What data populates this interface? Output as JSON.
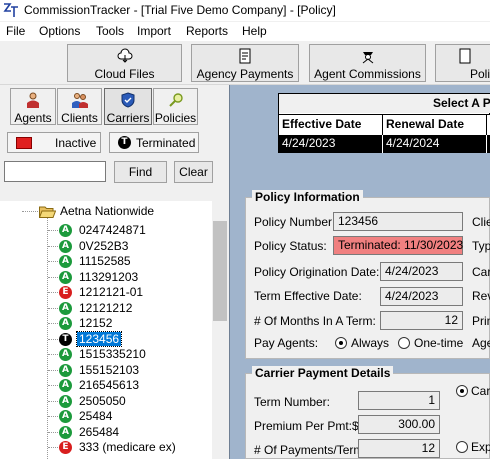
{
  "window": {
    "title": "CommissionTracker - [Trial Five Demo Company] - [Policy]"
  },
  "menu": [
    "File",
    "Options",
    "Tools",
    "Import",
    "Reports",
    "Help"
  ],
  "toolbar": {
    "cloud_files": "Cloud Files",
    "agency_payments": "Agency Payments",
    "agent_commissions": "Agent Commissions",
    "policies_partial": "Poli"
  },
  "left_tabs": {
    "agents": "Agents",
    "clients": "Clients",
    "carriers": "Carriers",
    "policies": "Policies"
  },
  "filters": {
    "inactive": "Inactive",
    "terminated": "Terminated"
  },
  "search": {
    "value": "",
    "find": "Find",
    "clear": "Clear"
  },
  "tree": {
    "root": "Aetna Nationwide",
    "items": [
      {
        "label": "0247424871",
        "status": "A"
      },
      {
        "label": "0V252B3",
        "status": "A"
      },
      {
        "label": "11152585",
        "status": "A"
      },
      {
        "label": "113291203",
        "status": "A"
      },
      {
        "label": "1212121-01",
        "status": "E"
      },
      {
        "label": "12121212",
        "status": "A"
      },
      {
        "label": "12152",
        "status": "A"
      },
      {
        "label": "123456",
        "status": "T"
      },
      {
        "label": "1515335210",
        "status": "A"
      },
      {
        "label": "155152103",
        "status": "A"
      },
      {
        "label": "216545613",
        "status": "A"
      },
      {
        "label": "2505050",
        "status": "A"
      },
      {
        "label": "25484",
        "status": "A"
      },
      {
        "label": "265484",
        "status": "A"
      },
      {
        "label": "333 (medicare ex)",
        "status": "E"
      }
    ]
  },
  "grid": {
    "title": "Select A P",
    "headers": [
      "Effective Date",
      "Renewal Date",
      "S"
    ],
    "row": [
      "4/24/2023",
      "4/24/2024",
      "T"
    ]
  },
  "policy_info": {
    "title": "Policy Information",
    "policy_number_label": "Policy Number:",
    "policy_number": "123456",
    "status_label": "Policy Status:",
    "status": "Terminated: 11/30/2023",
    "orig_label": "Policy Origination Date:",
    "orig_date": "4/24/2023",
    "term_eff_label": "Term Effective Date:",
    "term_eff_date": "4/24/2023",
    "months_label": "# Of Months In A Term:",
    "months": "12",
    "pay_agents_label": "Pay Agents:",
    "always": "Always",
    "one_time": "One-time",
    "right_labels": [
      "Clie",
      "Typ",
      "Car",
      "Rev",
      "Prin",
      "Age"
    ]
  },
  "carrier_payment": {
    "title": "Carrier Payment Details",
    "term_number_label": "Term Number:",
    "term_number": "1",
    "premium_label": "Premium Per Pmt:$",
    "premium": "300.00",
    "payments_label": "# Of Payments/Term:",
    "payments": "12",
    "right_opts": [
      "Carr",
      "Expe"
    ]
  },
  "colors": {
    "active": "#1c9a3c",
    "terminated": "#000000",
    "expired": "#d81e1e",
    "status_bg": "#f08080",
    "panel_bg": "#a0b4cc"
  }
}
